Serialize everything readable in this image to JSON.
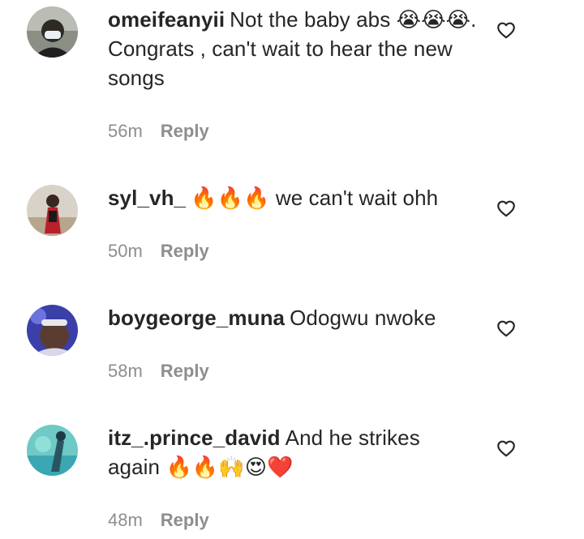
{
  "comments": [
    {
      "username": "omeifeanyii",
      "text": "Not the baby abs 😭😭😭. Congrats , can't wait to hear the new songs",
      "time": "56m",
      "reply": "Reply",
      "avatar_icon": "user-avatar"
    },
    {
      "username": "syl_vh_",
      "text": "🔥🔥🔥 we can't wait ohh",
      "time": "50m",
      "reply": "Reply",
      "avatar_icon": "user-avatar"
    },
    {
      "username": "boygeorge_muna",
      "text": "Odogwu nwoke",
      "time": "58m",
      "reply": "Reply",
      "avatar_icon": "user-avatar"
    },
    {
      "username": "itz_.prince_david",
      "text": "And he strikes again 🔥🔥🙌😍❤️",
      "time": "48m",
      "reply": "Reply",
      "avatar_icon": "user-avatar"
    }
  ],
  "like_icon": "heart-outline-icon",
  "colors": {
    "text": "#262626",
    "meta": "#8e8e8e"
  }
}
